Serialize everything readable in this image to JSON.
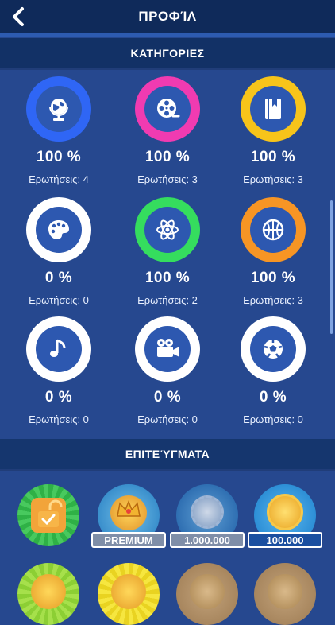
{
  "header": {
    "title": "ΠΡΟΦΊΛ",
    "back_icon": "chevron-left-icon"
  },
  "sections": {
    "categories": "ΚΑΤΗΓΟΡΙΕΣ",
    "achievements": "ΕΠΙΤΕΎΓΜΑΤΑ"
  },
  "categories": [
    {
      "icon": "globe-icon",
      "percent": "100 %",
      "questions": "Ερωτήσεις: 4",
      "ring": "#2f66f5"
    },
    {
      "icon": "film-reel-icon",
      "percent": "100 %",
      "questions": "Ερωτήσεις: 3",
      "ring": "#f03bb1"
    },
    {
      "icon": "book-icon",
      "percent": "100 %",
      "questions": "Ερωτήσεις: 3",
      "ring": "#f7c41a"
    },
    {
      "icon": "palette-icon",
      "percent": "0 %",
      "questions": "Ερωτήσεις: 0",
      "ring": "#ffffff"
    },
    {
      "icon": "atom-icon",
      "percent": "100 %",
      "questions": "Ερωτήσεις: 2",
      "ring": "#35dd5e"
    },
    {
      "icon": "basketball-icon",
      "percent": "100 %",
      "questions": "Ερωτήσεις: 3",
      "ring": "#f79524"
    },
    {
      "icon": "music-note-icon",
      "percent": "0 %",
      "questions": "Ερωτήσεις: 0",
      "ring": "#ffffff"
    },
    {
      "icon": "movie-camera-icon",
      "percent": "0 %",
      "questions": "Ερωτήσεις: 0",
      "ring": "#ffffff"
    },
    {
      "icon": "soccer-ball-icon",
      "percent": "0 %",
      "questions": "Ερωτήσεις: 0",
      "ring": "#ffffff"
    }
  ],
  "achievements": [
    {
      "icon": "unlocked-padlock-icon",
      "label": ""
    },
    {
      "icon": "crown-coins-icon",
      "label": "PREMIUM"
    },
    {
      "icon": "coin-stack-icon",
      "label": "1.000.000"
    },
    {
      "icon": "coin-stack-icon",
      "label": "100.000"
    }
  ]
}
